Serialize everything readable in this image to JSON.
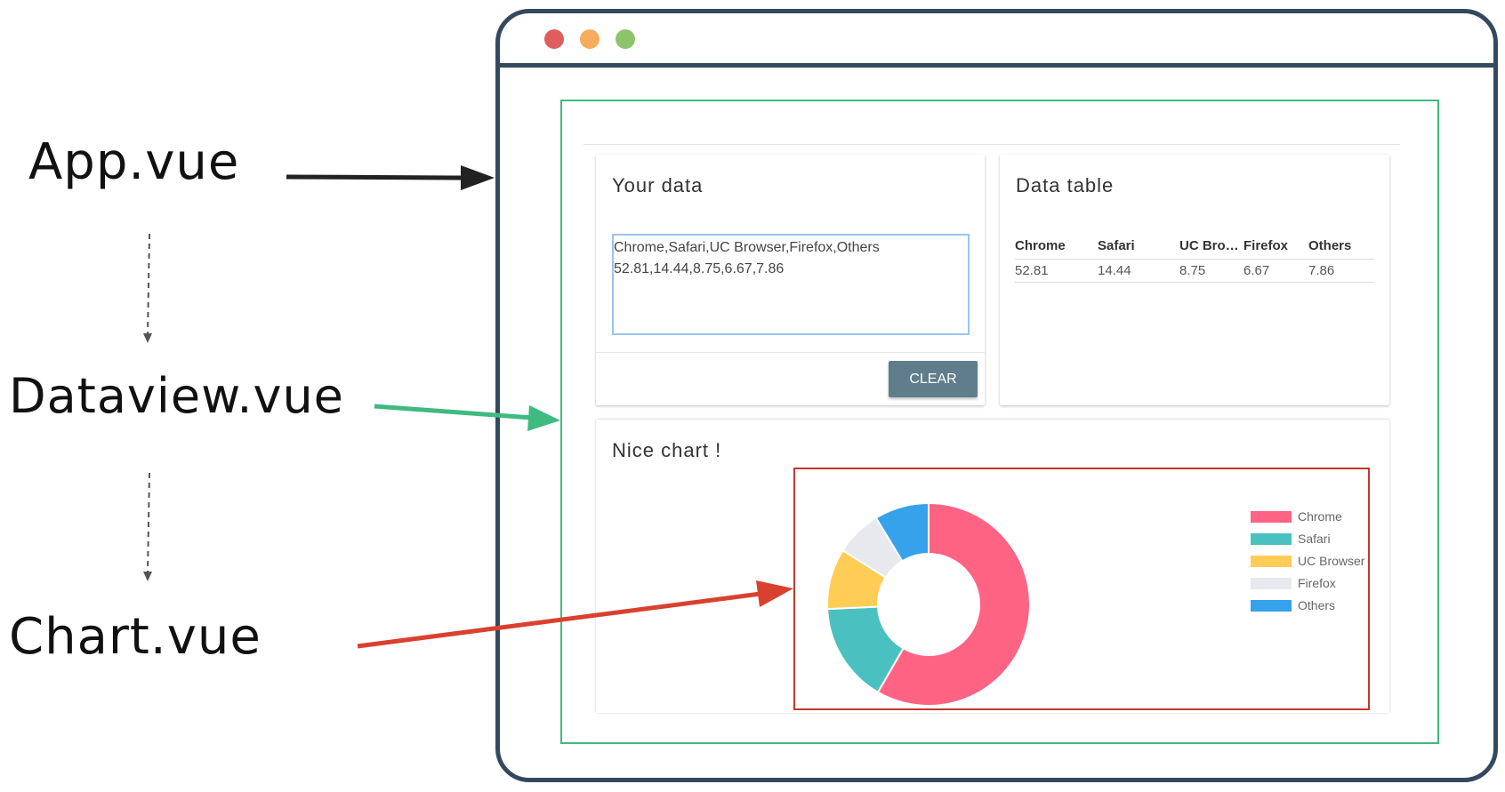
{
  "labels": {
    "app": "App.vue",
    "dataview": "Dataview.vue",
    "chart": "Chart.vue"
  },
  "colors": {
    "frame": "#34495e",
    "app_box": "#3fba80",
    "chart_box": "#c0392b",
    "arrow_app": "#222222",
    "arrow_dataview": "#3fba80",
    "arrow_chart": "#d9412f",
    "dot_close": "#e05d5d",
    "dot_minimize": "#f5ad5d",
    "dot_zoom": "#8bc46b",
    "clear_button": "#607d8b"
  },
  "data_card": {
    "title": "Your data",
    "textarea_value": "Chrome,Safari,UC Browser,Firefox,Others\n52.81,14.44,8.75,6.67,7.86",
    "clear_label": "CLEAR"
  },
  "table_card": {
    "title": "Data table",
    "headers": [
      "Chrome",
      "Safari",
      "UC Bro…",
      "Firefox",
      "Others"
    ],
    "row": [
      "52.81",
      "14.44",
      "8.75",
      "6.67",
      "7.86"
    ]
  },
  "chart_card": {
    "title": "Nice chart !"
  },
  "chart_data": {
    "type": "pie",
    "variant": "doughnut",
    "categories": [
      "Chrome",
      "Safari",
      "UC Browser",
      "Firefox",
      "Others"
    ],
    "values": [
      52.81,
      14.44,
      8.75,
      6.67,
      7.86
    ],
    "colors": [
      "#ff6384",
      "#4bc0c0",
      "#ffcd56",
      "#e7e9ed",
      "#36a2eb"
    ],
    "legend_position": "right"
  }
}
